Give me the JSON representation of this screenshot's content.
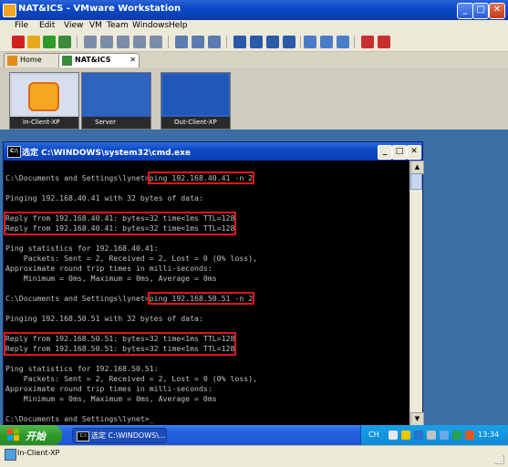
{
  "window": {
    "title": "NAT&ICS - VMware Workstation"
  },
  "menu": {
    "items": [
      "File",
      "Edit",
      "View",
      "VM",
      "Team",
      "Windows",
      "Help"
    ]
  },
  "tabs": [
    {
      "label": "Home"
    },
    {
      "label": "NAT&ICS"
    }
  ],
  "thumbnails": [
    {
      "label": "In-Client-XP"
    },
    {
      "label": "Server"
    },
    {
      "label": "Out-Client-XP"
    }
  ],
  "cmd": {
    "title": "选定 C:\\WINDOWS\\system32\\cmd.exe",
    "lines": [
      "",
      "C:\\Documents and Settings\\lynet>",
      "",
      "Pinging 192.168.40.41 with 32 bytes of data:",
      "",
      "Reply from 192.168.40.41: bytes=32 time<1ms TTL=128",
      "Reply from 192.168.40.41: bytes=32 time<1ms TTL=128",
      "",
      "Ping statistics for 192.168.40.41:",
      "    Packets: Sent = 2, Received = 2, Lost = 0 (0% loss),",
      "Approximate round trip times in milli-seconds:",
      "    Minimum = 0ms, Maximum = 0ms, Average = 0ms",
      "",
      "C:\\Documents and Settings\\lynet>",
      "",
      "Pinging 192.168.50.51 with 32 bytes of data:",
      "",
      "Reply from 192.168.50.51: bytes=32 time<1ms TTL=128",
      "Reply from 192.168.50.51: bytes=32 time<1ms TTL=128",
      "",
      "Ping statistics for 192.168.50.51:",
      "    Packets: Sent = 2, Received = 2, Lost = 0 (0% loss),",
      "Approximate round trip times in milli-seconds:",
      "    Minimum = 0ms, Maximum = 0ms, Average = 0ms",
      "",
      "C:\\Documents and Settings\\lynet>_"
    ],
    "commands": [
      "ping 192.168.40.41 -n 2",
      "ping 192.168.50.51 -n 2"
    ]
  },
  "taskbar": {
    "start_label": "开始",
    "task_label": "选定 C:\\WINDOWS\\...",
    "lang": "CH",
    "clock": "13:34"
  },
  "status": {
    "vm_name": "In-Client-XP"
  },
  "colors": {
    "highlight": "#e0161b",
    "titlebar": "#0b49c6",
    "desktop": "#3a6ea5"
  }
}
